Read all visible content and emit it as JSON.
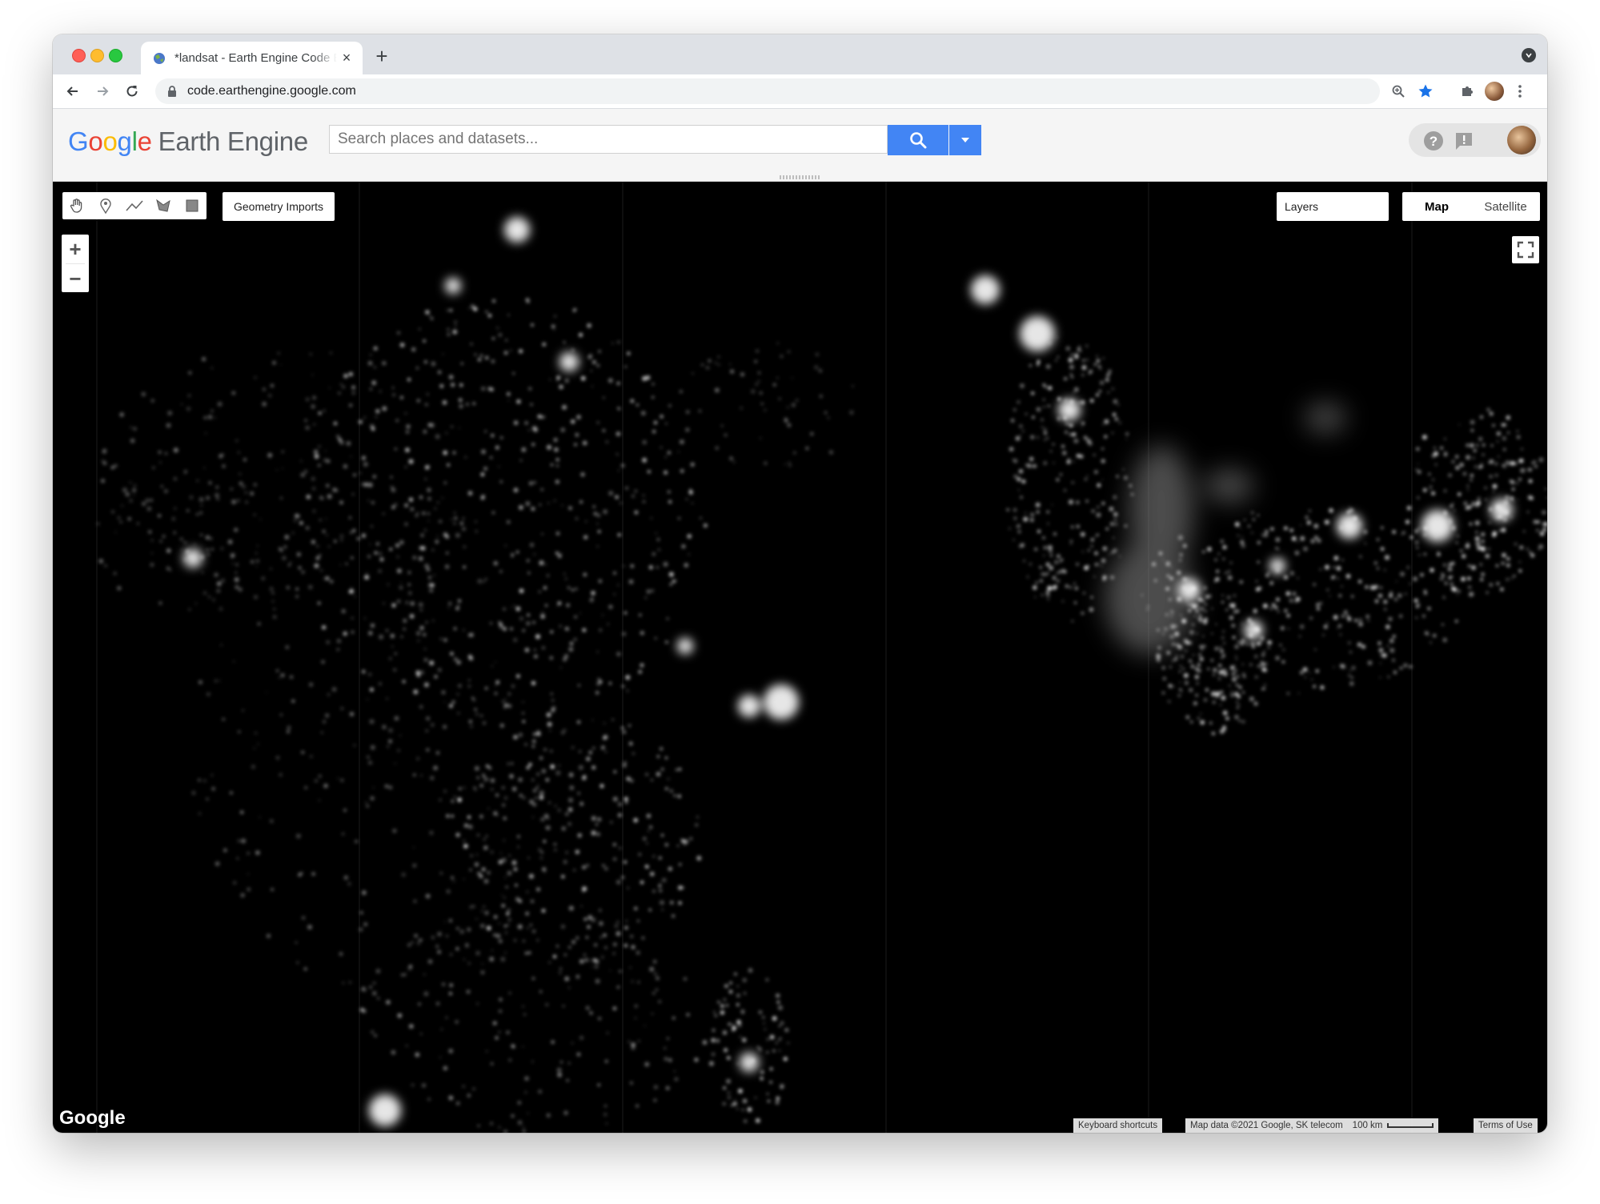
{
  "browser": {
    "tab_title": "*landsat - Earth Engine Code Editor",
    "tab_close": "×",
    "new_tab": "+",
    "url": "code.earthengine.google.com"
  },
  "header": {
    "logo_google": [
      "G",
      "o",
      "o",
      "g",
      "l",
      "e"
    ],
    "logo_product": "Earth Engine",
    "search_placeholder": "Search places and datasets..."
  },
  "map": {
    "geometry_imports": "Geometry Imports",
    "zoom_in": "+",
    "zoom_out": "−",
    "layers": "Layers",
    "map_type": {
      "map": "Map",
      "satellite": "Satellite",
      "selected": "Map"
    },
    "watermark": "Google",
    "attribution": {
      "keyboard_shortcuts": "Keyboard shortcuts",
      "map_data": "Map data ©2021 Google, SK telecom",
      "scale": "100 km",
      "terms": "Terms of Use"
    }
  },
  "colors": {
    "accent": "#4285f4",
    "map_background": "#000000",
    "header_background": "#f5f5f5"
  }
}
